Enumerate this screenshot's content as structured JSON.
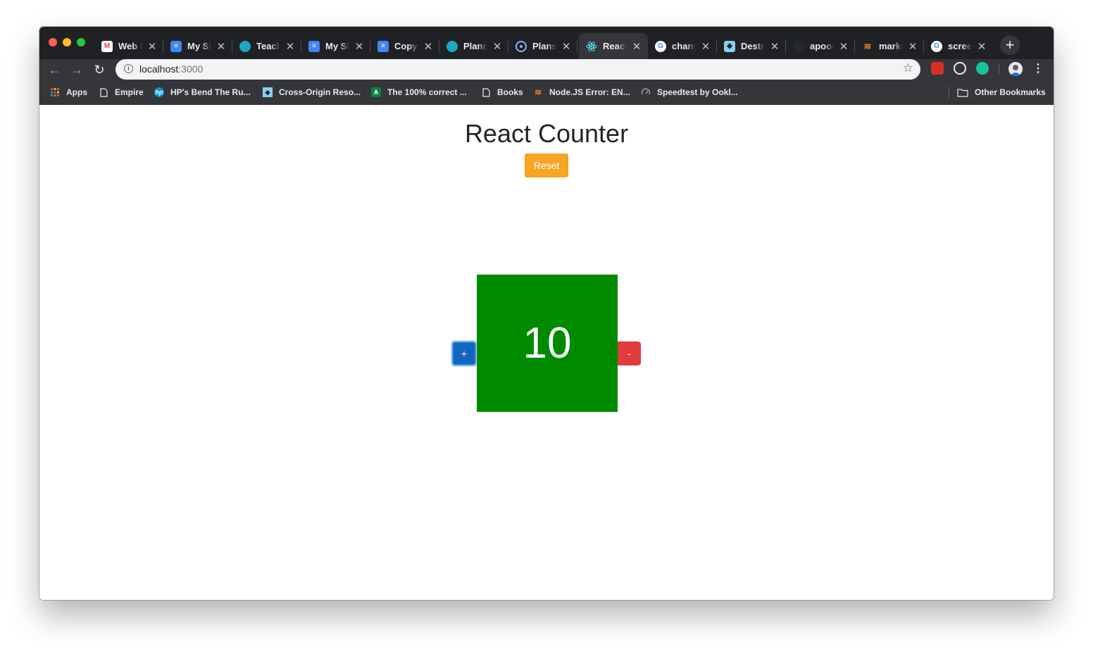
{
  "browser": {
    "tabs": [
      {
        "title": "Web D",
        "favicon": "gmail-icon",
        "color": "#ea4335",
        "active": false
      },
      {
        "title": "My Sk",
        "favicon": "google-docs-icon",
        "color": "#4285f4",
        "active": false
      },
      {
        "title": "Teach",
        "favicon": "globe-icon",
        "color": "#1ca7c9",
        "active": false
      },
      {
        "title": "My Sk",
        "favicon": "google-docs-icon",
        "color": "#4285f4",
        "active": false
      },
      {
        "title": "Copy",
        "favicon": "google-docs-icon",
        "color": "#4285f4",
        "active": false
      },
      {
        "title": "Planni",
        "favicon": "globe-icon",
        "color": "#1ca7c9",
        "active": false
      },
      {
        "title": "Plans",
        "favicon": "target-icon",
        "color": "#8ab4f8",
        "active": false
      },
      {
        "title": "React",
        "favicon": "react-icon",
        "color": "#61dafb",
        "active": true
      },
      {
        "title": "chang",
        "favicon": "google-icon",
        "color": "#ffffff",
        "active": false
      },
      {
        "title": "Destr",
        "favicon": "mdn-icon",
        "color": "#83d0f2",
        "active": false
      },
      {
        "title": "apoor",
        "favicon": "github-icon",
        "color": "#24292e",
        "active": false
      },
      {
        "title": "marke",
        "favicon": "stackoverflow-icon",
        "color": "#f48024",
        "active": false
      },
      {
        "title": "screei",
        "favicon": "google-icon",
        "color": "#ffffff",
        "active": false
      }
    ],
    "new_tab_label": "+",
    "close_glyph": "✕",
    "url_host": "localhost",
    "url_port": ":3000",
    "bookmarks": [
      {
        "label": "Apps",
        "icon": "apps-grid-icon"
      },
      {
        "label": "Empire",
        "icon": "page-icon"
      },
      {
        "label": "HP's Bend The Ru...",
        "icon": "hp-icon"
      },
      {
        "label": "Cross-Origin Reso...",
        "icon": "mdn-icon"
      },
      {
        "label": "The 100% correct ...",
        "icon": "android-icon"
      },
      {
        "label": "Books",
        "icon": "page-icon"
      },
      {
        "label": "Node.JS Error: EN...",
        "icon": "stackoverflow-icon"
      },
      {
        "label": "Speedtest by Ookl...",
        "icon": "speedtest-icon"
      }
    ],
    "other_bookmarks": "Other Bookmarks"
  },
  "page": {
    "title": "React Counter",
    "reset_label": "Reset",
    "counter_value": "10",
    "increment_label": "+",
    "decrement_label": "-",
    "counter_color": "#008a00"
  }
}
